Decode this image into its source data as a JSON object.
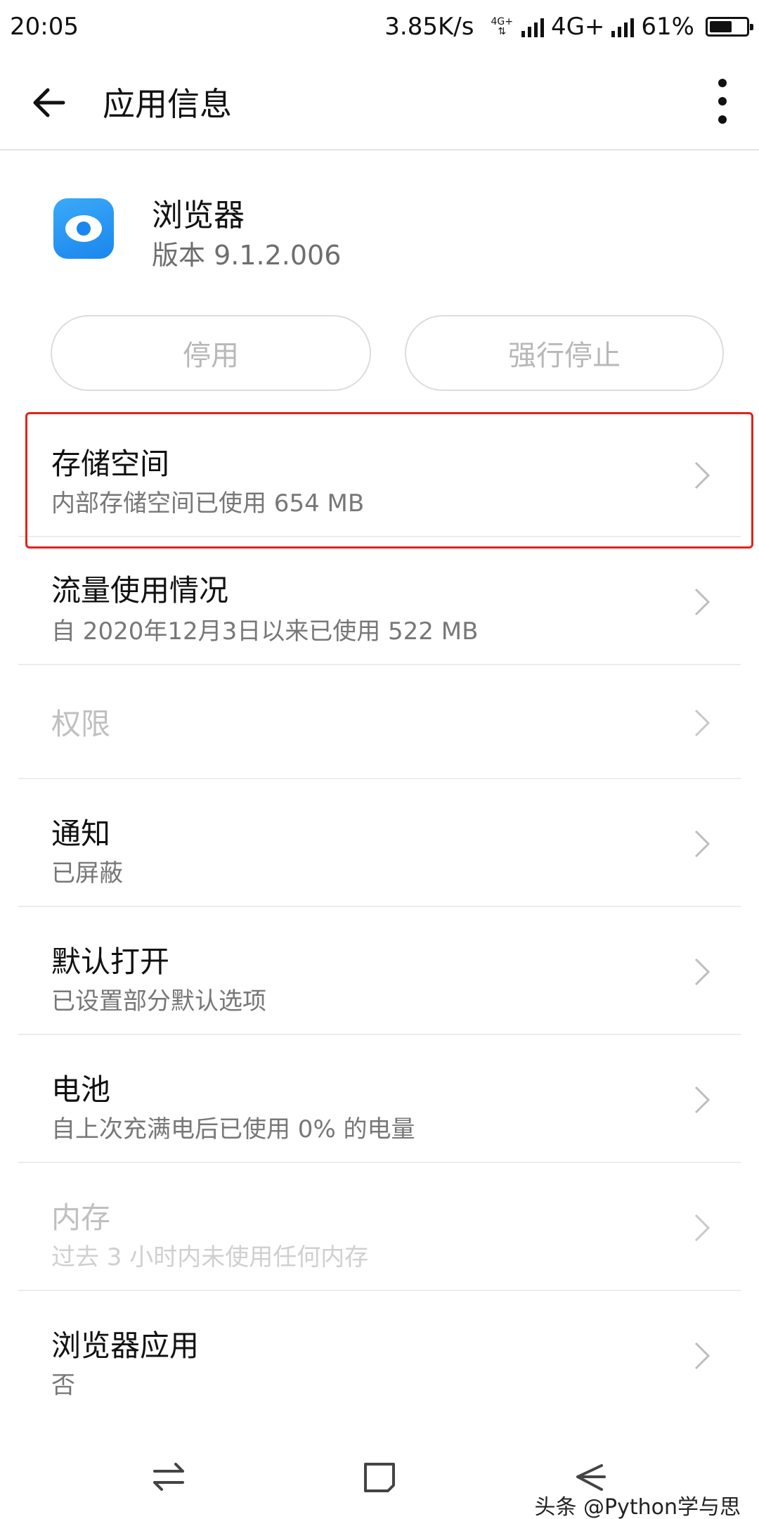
{
  "status_bar": {
    "time": "20:05",
    "net_speed": "3.85K/s",
    "sim1_tag": "4G+",
    "sim2_label": "4G+",
    "battery_percent": "61%",
    "battery_level": 0.61
  },
  "app_bar": {
    "title": "应用信息",
    "back_icon": "arrow-left-icon",
    "more_icon": "more-vertical-icon"
  },
  "app": {
    "name": "浏览器",
    "version": "版本 9.1.2.006",
    "icon": "browser-app-icon",
    "icon_color": "#1a86ee"
  },
  "actions": {
    "disable_label": "停用",
    "force_stop_label": "强行停止"
  },
  "items": [
    {
      "title": "存储空间",
      "subtitle": "内部存储空间已使用 654 MB"
    },
    {
      "title": "流量使用情况",
      "subtitle": "自 2020年12月3日以来已使用 522 MB"
    },
    {
      "title": "权限",
      "subtitle": ""
    },
    {
      "title": "通知",
      "subtitle": "已屏蔽"
    },
    {
      "title": "默认打开",
      "subtitle": "已设置部分默认选项"
    },
    {
      "title": "电池",
      "subtitle": "自上次充满电后已使用 0% 的电量"
    },
    {
      "title": "内存",
      "subtitle": "过去 3 小时内未使用任何内存"
    },
    {
      "title": "浏览器应用",
      "subtitle": "否"
    }
  ],
  "highlight_color": "#e2231a",
  "watermark": "头条 @Python学与思"
}
